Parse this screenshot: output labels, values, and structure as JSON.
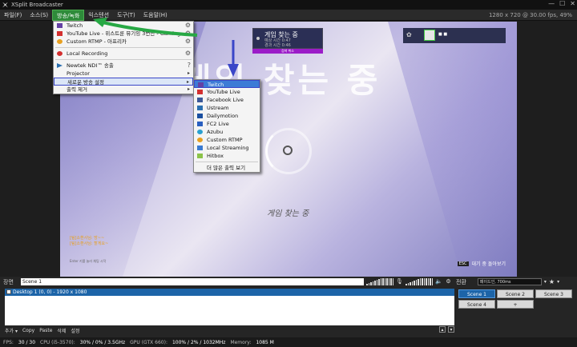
{
  "titlebar": {
    "title": "XSplit Broadcaster",
    "min": "—",
    "max": "☐",
    "close": "✕"
  },
  "menubar": {
    "items": [
      "파일(F)",
      "소스(S)",
      "방송/녹화",
      "익스텐션",
      "도구(T)",
      "도움말(H)"
    ],
    "resolution_info": "1280 x 720 @ 30.00 fps, 49%"
  },
  "broadcast_menu": {
    "items": [
      {
        "label": "Twitch",
        "icon": "twitch-icon",
        "gear": true
      },
      {
        "label": "YouTube Live - 위스트룬 뮤기잉 3번만 - Gaming",
        "icon": "youtube-icon",
        "gear": true
      },
      {
        "label": "Custom RTMP - 아프리카",
        "icon": "rtmp-icon",
        "gear": true
      },
      {
        "label": "Local Recording",
        "icon": "record-icon",
        "gear": true
      },
      {
        "label": "Newtek NDI™ 송출",
        "icon": "ndi-icon",
        "gear": false,
        "help": true
      },
      {
        "label": "Projector",
        "icon": "",
        "arrow": true
      },
      {
        "label": "새로운 방송 설정",
        "icon": "",
        "arrow": true,
        "highlight": true
      },
      {
        "label": "출력 제거",
        "icon": "",
        "arrow": true
      }
    ]
  },
  "new_output_menu": {
    "items": [
      {
        "label": "Twitch",
        "icon": "twitch-icon",
        "color": "#6441a4"
      },
      {
        "label": "YouTube Live",
        "icon": "youtube-icon",
        "color": "#d32f2f"
      },
      {
        "label": "Facebook Live",
        "icon": "facebook-icon",
        "color": "#3b5998"
      },
      {
        "label": "Ustream",
        "icon": "ustream-icon",
        "color": "#2a6fb0"
      },
      {
        "label": "Dailymotion",
        "icon": "dailymotion-icon",
        "color": "#1a4fa0"
      },
      {
        "label": "FC2 Live",
        "icon": "fc2-icon",
        "color": "#2a5fc0"
      },
      {
        "label": "Azubu",
        "icon": "azubu-icon",
        "color": "#2aa0d0"
      },
      {
        "label": "Custom RTMP",
        "icon": "rtmp-icon",
        "color": "#e8a020"
      },
      {
        "label": "Local Streaming",
        "icon": "network-icon",
        "color": "#3a7ad0"
      },
      {
        "label": "Hitbox",
        "icon": "hitbox-icon",
        "color": "#8bc34a"
      },
      {
        "label": "더 많은 출력 보기",
        "icon": "",
        "color": "#ffffff"
      }
    ]
  },
  "stage": {
    "big_title": "게임 찾는 중",
    "match_title": "게임 찾는 중",
    "match_line1": "예상 시간 0:47",
    "match_line2": "경과 시간 0:46",
    "cancel": "검색 취소",
    "searching": "게임 찾는 중",
    "chat_line1": "[팀]소환사님: 방~~",
    "chat_line2": "[팀]소환사님: 할게요~",
    "chat_hint": "Enter 키를 눌러 채팅 시작",
    "esc_key": "ESC",
    "esc_label": "대기 중 돌아보기"
  },
  "bottom": {
    "scene_label": "장면",
    "scene_name": "Scene 1",
    "source_item": "Desktop 1 (0, 0) - 1920 x 1080",
    "toolbar": [
      "추가 ▾",
      "Copy",
      "Paste",
      "삭제",
      "설정"
    ],
    "transition_label": "전환",
    "transition_value": "페이드인, 700ms",
    "scenes": [
      "Scene 1",
      "Scene 2",
      "Scene 3",
      "Scene 4",
      "+"
    ]
  },
  "statusbar": {
    "fps_label": "FPS:",
    "fps": "30 / 30",
    "cpu_label": "CPU (i5-3570):",
    "cpu": "30% / 0% / 3.5GHz",
    "gpu_label": "GPU (GTX 660):",
    "gpu": "100% / 2% / 1032MHz",
    "mem_label": "Memory:",
    "mem": "1085 M"
  }
}
